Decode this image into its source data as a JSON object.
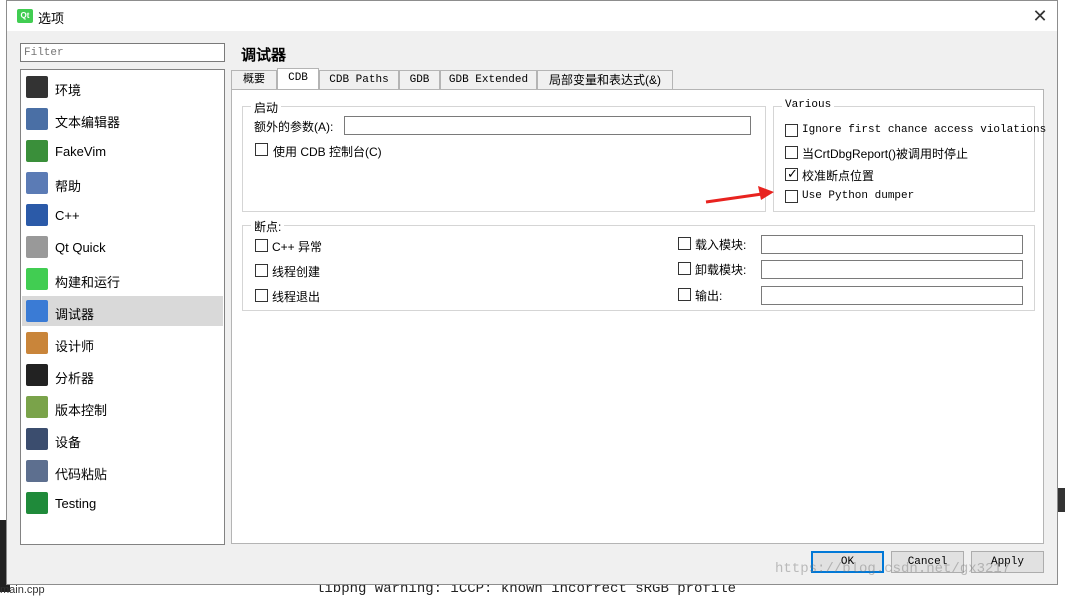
{
  "window": {
    "title": "选项",
    "close": "✕"
  },
  "filter": {
    "placeholder": "Filter"
  },
  "sidebar": {
    "items": [
      {
        "label": "环境",
        "color": "#333"
      },
      {
        "label": "文本编辑器",
        "color": "#4a6fa5"
      },
      {
        "label": "FakeVim",
        "color": "#3a8f3a"
      },
      {
        "label": "帮助",
        "color": "#5b7bb5"
      },
      {
        "label": "C++",
        "color": "#2b5aa8"
      },
      {
        "label": "Qt Quick",
        "color": "#999"
      },
      {
        "label": "构建和运行",
        "color": "#41cd52"
      },
      {
        "label": "调试器",
        "color": "#3a7bd5"
      },
      {
        "label": "设计师",
        "color": "#c9853a"
      },
      {
        "label": "分析器",
        "color": "#222"
      },
      {
        "label": "版本控制",
        "color": "#7aa34a"
      },
      {
        "label": "设备",
        "color": "#3b4d6e"
      },
      {
        "label": "代码粘贴",
        "color": "#5d6f8f"
      },
      {
        "label": "Testing",
        "color": "#1f8a3a"
      }
    ],
    "active_index": 7
  },
  "page": {
    "title": "调试器"
  },
  "tabs": [
    "概要",
    "CDB",
    "CDB Paths",
    "GDB",
    "GDB Extended",
    "局部变量和表达式(&)"
  ],
  "startup": {
    "title": "启动",
    "extra_args_label": "额外的参数(A):",
    "extra_args_value": "",
    "use_console_label": "使用 CDB 控制台(C)"
  },
  "various": {
    "title": "Various",
    "items": [
      {
        "label": "Ignore first chance access violations",
        "checked": false
      },
      {
        "label": "当CrtDbgReport()被调用时停止",
        "checked": false
      },
      {
        "label": "校准断点位置",
        "checked": true
      },
      {
        "label": "Use Python dumper",
        "checked": false
      }
    ]
  },
  "breakpoints": {
    "title": "断点:",
    "left": [
      {
        "label": "C++ 异常"
      },
      {
        "label": "线程创建"
      },
      {
        "label": "线程退出"
      }
    ],
    "right": [
      {
        "label": "载入模块:",
        "value": ""
      },
      {
        "label": "卸载模块:",
        "value": ""
      },
      {
        "label": "输出:",
        "value": ""
      }
    ]
  },
  "buttons": {
    "ok": "OK",
    "cancel": "Cancel",
    "apply": "Apply"
  },
  "background": {
    "code_line": "libpng warning: iCCP: known incorrect sRGB profile",
    "file_tab": "main.cpp",
    "watermark": "https://blog.csdn.net/gx3217"
  },
  "colors": {
    "arrow": "#e8231f",
    "accent": "#0078d7"
  }
}
